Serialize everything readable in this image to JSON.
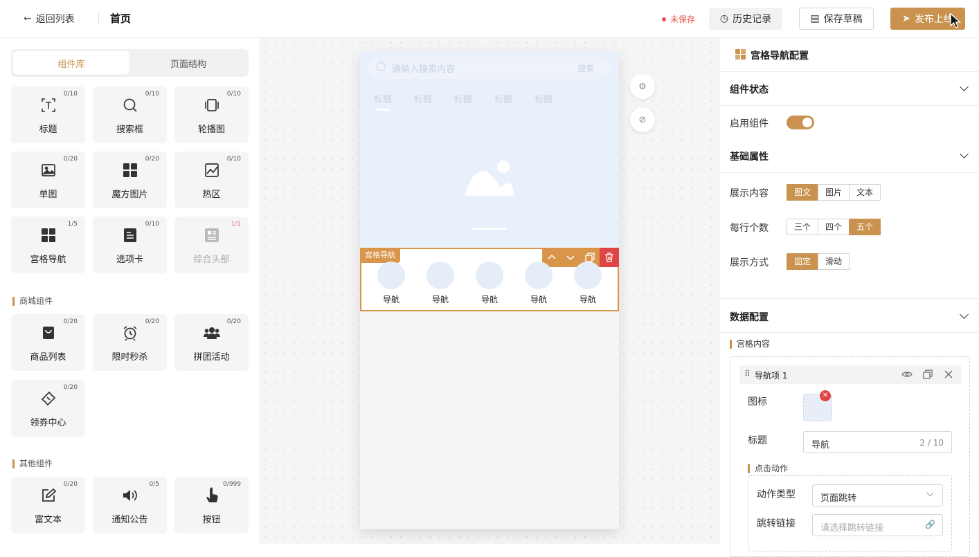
{
  "header": {
    "back_label": "返回列表",
    "page_title": "首页",
    "unsaved": "未保存",
    "history": "历史记录",
    "save_draft": "保存草稿",
    "publish": "发布上线"
  },
  "left": {
    "tabs": [
      "组件库",
      "页面结构"
    ],
    "basic": [
      {
        "label": "标题",
        "count": "0/10",
        "icon": "title-icon"
      },
      {
        "label": "搜索框",
        "count": "0/10",
        "icon": "search-icon"
      },
      {
        "label": "轮播图",
        "count": "0/10",
        "icon": "carousel-icon"
      },
      {
        "label": "单图",
        "count": "0/20",
        "icon": "image-icon"
      },
      {
        "label": "魔方图片",
        "count": "0/20",
        "icon": "cube-icon"
      },
      {
        "label": "热区",
        "count": "0/10",
        "icon": "hotzone-icon"
      },
      {
        "label": "宫格导航",
        "count": "1/5",
        "icon": "grid-icon"
      },
      {
        "label": "选项卡",
        "count": "0/10",
        "icon": "tabcard-icon"
      },
      {
        "label": "综合头部",
        "count": "1/1",
        "icon": "header-icon"
      }
    ],
    "section_mall": "商城组件",
    "mall": [
      {
        "label": "商品列表",
        "count": "0/20",
        "icon": "bag-icon"
      },
      {
        "label": "限时秒杀",
        "count": "0/20",
        "icon": "alarm-icon"
      },
      {
        "label": "拼团活动",
        "count": "0/20",
        "icon": "group-icon"
      },
      {
        "label": "领券中心",
        "count": "0/20",
        "icon": "coupon-icon"
      }
    ],
    "section_other": "其他组件",
    "other": [
      {
        "label": "富文本",
        "count": "0/20",
        "icon": "edit-icon"
      },
      {
        "label": "通知公告",
        "count": "0/5",
        "icon": "speaker-icon"
      },
      {
        "label": "按钮",
        "count": "0/999",
        "icon": "hand-icon"
      }
    ]
  },
  "phone": {
    "search_placeholder": "请输入搜索内容",
    "search_button": "搜索",
    "tabs": [
      "标题",
      "标题",
      "标题",
      "标题",
      "标题"
    ],
    "grid_tag": "宫格导航",
    "nav_items": [
      "导航",
      "导航",
      "导航",
      "导航",
      "导航"
    ]
  },
  "right": {
    "panel_title": "宫格导航配置",
    "section_state": "组件状态",
    "enable_label": "启用组件",
    "enabled": true,
    "section_basic": "基础属性",
    "display_label": "展示内容",
    "display_options": [
      "图文",
      "图片",
      "文本"
    ],
    "display_selected": "图文",
    "per_row_label": "每行个数",
    "per_row_options": [
      "三个",
      "四个",
      "五个"
    ],
    "per_row_selected": "五个",
    "mode_label": "展示方式",
    "mode_options": [
      "固定",
      "滑动"
    ],
    "mode_selected": "固定",
    "section_data": "数据配置",
    "grid_content": "宫格内容",
    "item_title": "导航项 1",
    "icon_label": "图标",
    "title_label": "标题",
    "title_value": "导航",
    "title_count": "2 / 10",
    "click_action": "点击动作",
    "action_type_label": "动作类型",
    "action_type_value": "页面跳转",
    "link_label": "跳转链接",
    "link_placeholder": "请选择跳转链接"
  },
  "colors": {
    "accent": "#c9934f",
    "danger": "#e04545",
    "grid_border": "#d9964a"
  }
}
